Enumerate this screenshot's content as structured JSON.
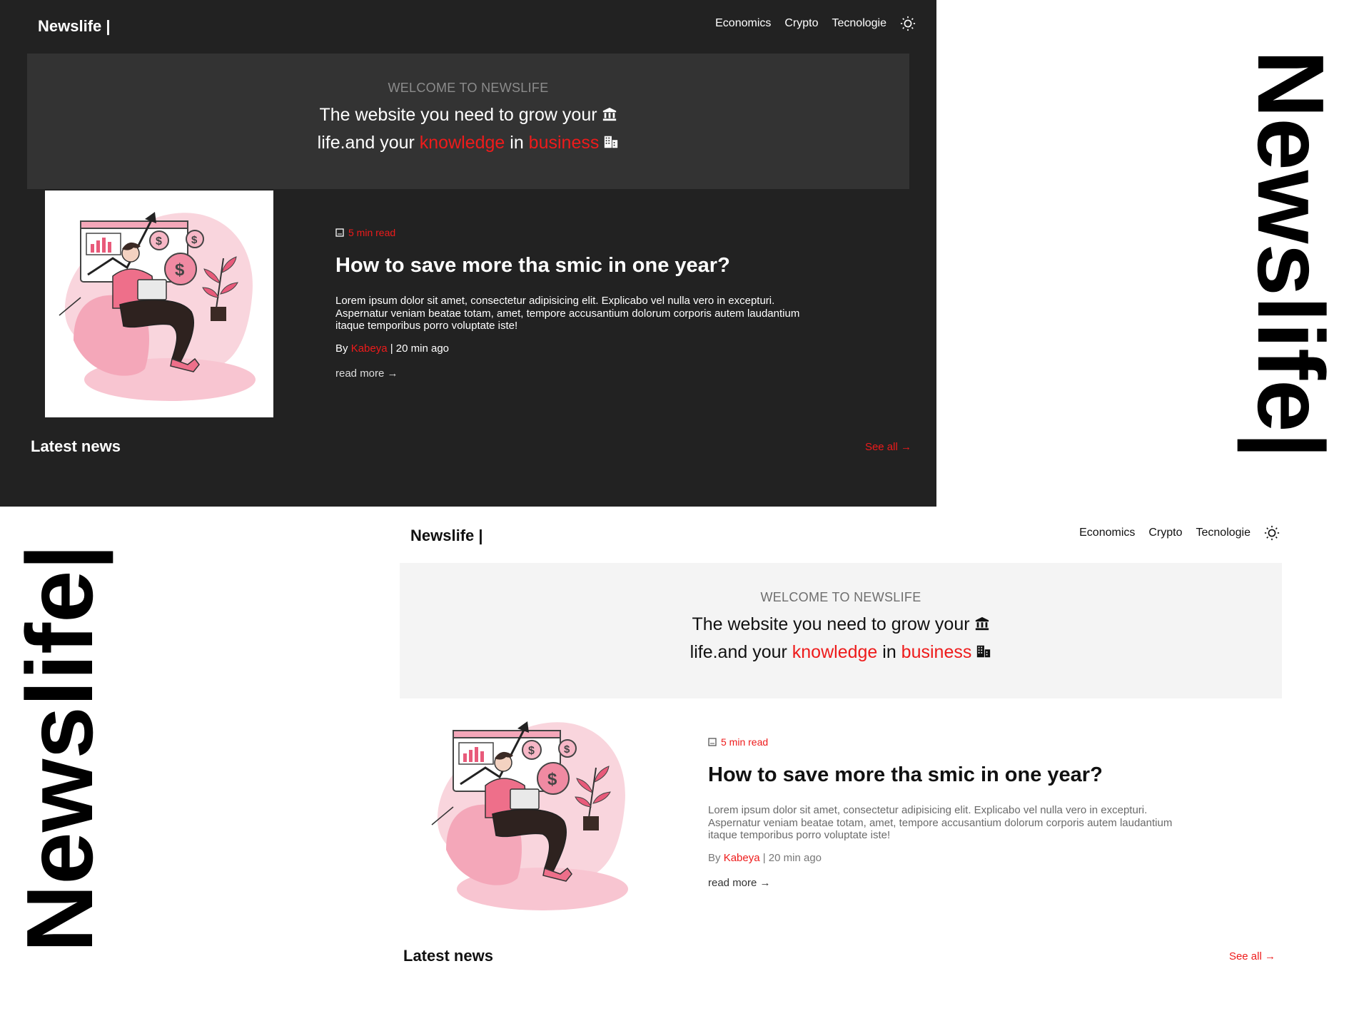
{
  "wordmark": "Newslife|",
  "brand": "Newslife |",
  "nav": {
    "items": [
      "Economics",
      "Crypto",
      "Tecnologie"
    ],
    "theme_toggle_icon": "sun-icon"
  },
  "hero": {
    "eyebrow": "WELCOME TO NEWSLIFE",
    "line1": "The website you need to grow your",
    "line1_icon": "bank-icon",
    "line2_a": "life.and your ",
    "line2_hl1": "knowledge",
    "line2_b": " in ",
    "line2_hl2": "business",
    "line2_icon": "buildings-icon"
  },
  "article": {
    "illustration": "man-with-laptop-finance-illustration",
    "read_time": "5 min read",
    "title": "How to save more tha smic in one year?",
    "excerpt": "Lorem ipsum dolor sit amet, consectetur adipisicing elit. Explicabo vel nulla vero in excepturi. Aspernatur veniam beatae totam, amet, tempore accusantium dolorum corporis autem laudantium itaque temporibus porro voluptate iste!",
    "by": "By ",
    "author": "Kabeya",
    "time": " | 20 min ago",
    "read_more": "read more →"
  },
  "latest": {
    "heading": "Latest news",
    "see_all": "See all →"
  },
  "colors": {
    "accent": "#ee1b1b",
    "dark_bg": "#222222",
    "dark_hero": "#333333",
    "light_hero": "#f4f4f4"
  }
}
